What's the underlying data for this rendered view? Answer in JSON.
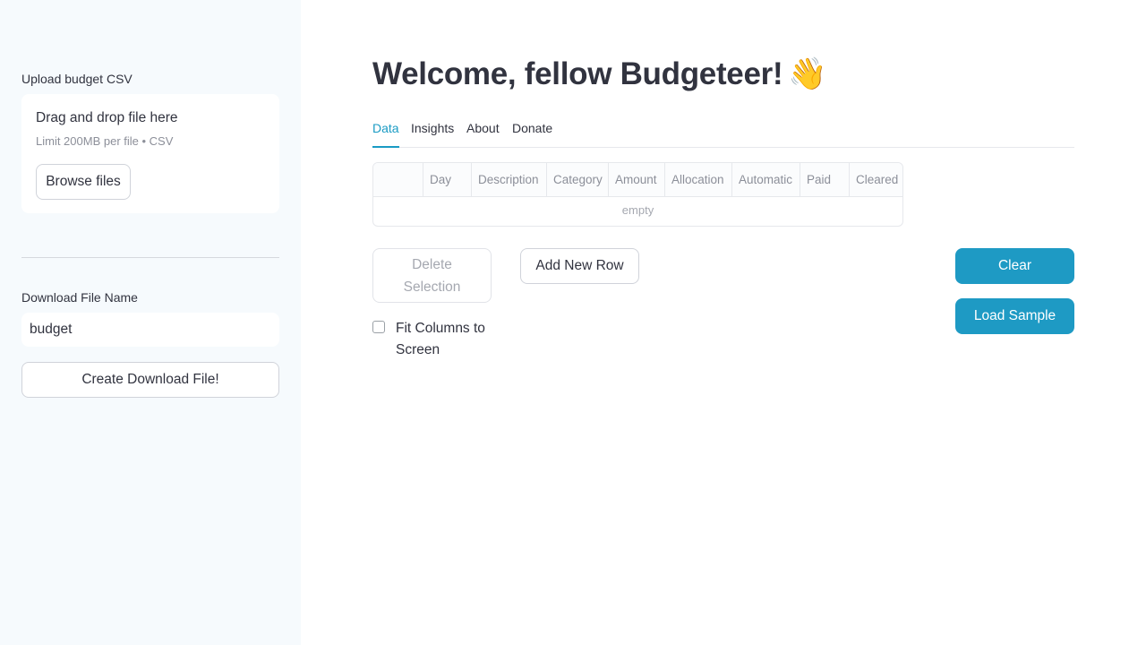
{
  "sidebar": {
    "upload_label": "Upload budget CSV",
    "uploader": {
      "title": "Drag and drop file here",
      "limit": "Limit 200MB per file • CSV",
      "browse_label": "Browse files"
    },
    "download_label": "Download File Name",
    "download_value": "budget",
    "create_label": "Create Download File!"
  },
  "main": {
    "title": "Welcome, fellow Budgeteer!",
    "title_emoji": "👋",
    "tabs": [
      {
        "label": "Data",
        "active": true
      },
      {
        "label": "Insights",
        "active": false
      },
      {
        "label": "About",
        "active": false
      },
      {
        "label": "Donate",
        "active": false
      }
    ],
    "grid": {
      "columns": [
        "Day",
        "Description",
        "Category",
        "Amount",
        "Allocation",
        "Automatic",
        "Paid",
        "Cleared"
      ],
      "empty_text": "empty"
    },
    "buttons": {
      "delete_line1": "Delete",
      "delete_line2": "Selection",
      "add_row": "Add New Row",
      "clear": "Clear",
      "load_sample": "Load Sample"
    },
    "fit_columns_label": "Fit Columns to Screen"
  },
  "colors": {
    "accent": "#1e9ac4",
    "sidebar_bg": "#f6fafd",
    "text": "#31333f"
  }
}
